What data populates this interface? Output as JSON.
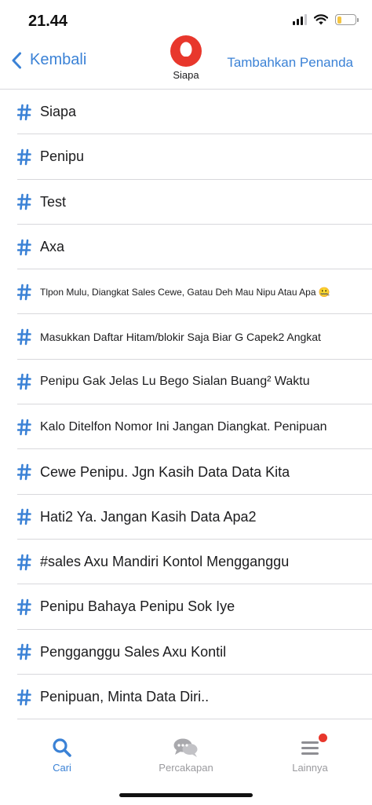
{
  "status_bar": {
    "time": "21.44",
    "battery_level": 0.25,
    "battery_color": "#f5c542"
  },
  "nav": {
    "back_label": "Kembali",
    "title": "Siapa",
    "add_tag_label": "Tambahkan Penanda",
    "accent_color": "#3b82d6",
    "avatar_color": "#e8372c"
  },
  "tags": [
    {
      "label": "Siapa",
      "size": "lg"
    },
    {
      "label": "Penipu",
      "size": "lg"
    },
    {
      "label": "Test",
      "size": "lg"
    },
    {
      "label": "Axa",
      "size": "lg"
    },
    {
      "label": "Tlpon Mulu, Diangkat Sales Cewe, Gatau Deh Mau Nipu Atau Apa 🤐",
      "size": "xs"
    },
    {
      "label": "Masukkan Daftar Hitam/blokir Saja Biar G Capek2 Angkat",
      "size": "sm"
    },
    {
      "label": "Penipu Gak Jelas Lu Bego Sialan Buang² Waktu",
      "size": "md"
    },
    {
      "label": "Kalo Ditelfon Nomor Ini Jangan Diangkat. Penipuan",
      "size": "md"
    },
    {
      "label": "Cewe Penipu. Jgn Kasih Data Data Kita",
      "size": "lg"
    },
    {
      "label": "Hati2 Ya. Jangan Kasih Data Apa2",
      "size": "lg"
    },
    {
      "label": "#sales Axu Mandiri Kontol Mengganggu",
      "size": "lg"
    },
    {
      "label": "Penipu Bahaya Penipu Sok Iye",
      "size": "lg"
    },
    {
      "label": "Pengganggu Sales Axu Kontil",
      "size": "lg"
    },
    {
      "label": "Penipuan, Minta Data Diri..",
      "size": "lg"
    }
  ],
  "tab_bar": {
    "tabs": [
      {
        "label": "Cari",
        "icon": "search-icon",
        "active": true
      },
      {
        "label": "Percakapan",
        "icon": "chat-bubbles-icon",
        "active": false
      },
      {
        "label": "Lainnya",
        "icon": "menu-icon",
        "active": false,
        "badge": true
      }
    ]
  }
}
